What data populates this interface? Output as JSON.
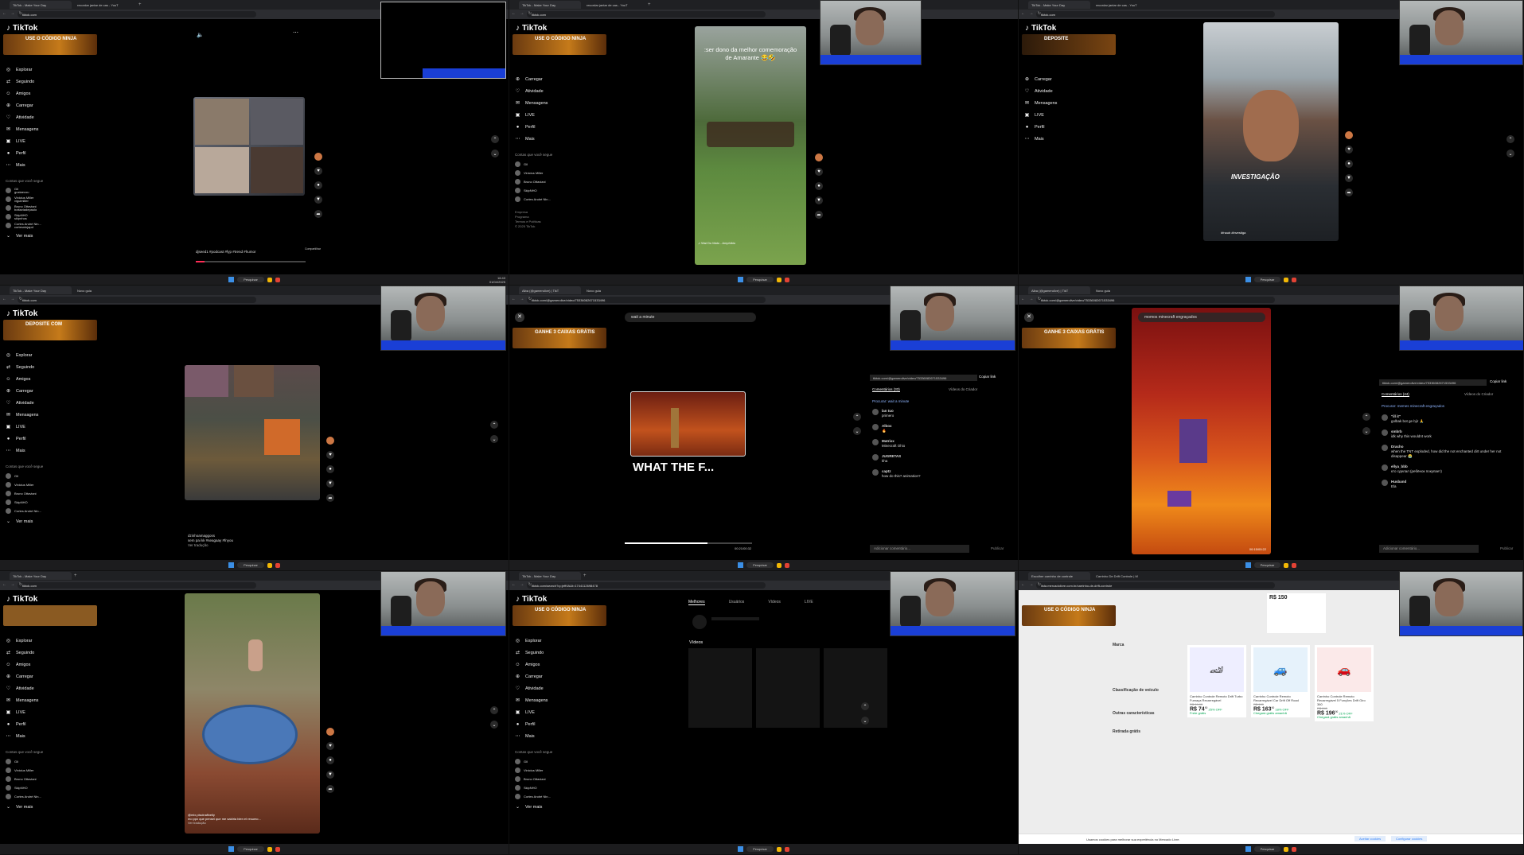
{
  "panels": [
    {
      "tabs": [
        "TikTok - Make Your Day",
        "recordar jantar de cas - YouT"
      ],
      "url": "tiktok.com",
      "logo": "TikTok",
      "banner": "USE O CÓDIGO NINJA",
      "sidebar": [
        "Explorar",
        "Seguindo",
        "Amigos",
        "Carregar",
        "Atividade",
        "Mensagens",
        "LIVE",
        "Perfil",
        "Mais"
      ],
      "following_heading": "Contas que você segue",
      "accounts": [
        {
          "name": "Gil",
          "handle": "gustaecou"
        },
        {
          "name": "Vinicius Miller",
          "handle": "viguimiller"
        },
        {
          "name": "Bruno Ottaviani",
          "handle": "bottaviadepaulo"
        },
        {
          "name": "SkipNHO",
          "handle": "skipnhos"
        },
        {
          "name": "Cortes André Nin...",
          "handle": "cortesninjapd"
        }
      ],
      "see_more": "Ver mais",
      "caption": "djseed1 #podcast #fyp #trend #humor",
      "share_label": "Compartilhar"
    },
    {
      "tabs": [
        "TikTok - Make Your Day",
        "recordar jantar de cas - YouT"
      ],
      "url": "tiktok.com",
      "banner": "USE O CÓDIGO NINJA",
      "overlay": ":ser dono da melhor comemoração de Amarante 😂🤣",
      "sidebar": [
        "Carregar",
        "Atividade",
        "Mensagens",
        "LIVE",
        "Perfil",
        "Mais"
      ],
      "footer": [
        "Empresa",
        "Programa",
        "Termos e Políticas",
        "© 2025 TikTok"
      ],
      "music": "♫ Wai Do Mato - Amphibio"
    },
    {
      "tabs": [
        "TikTok - Make Your Day",
        "recordar jantar de cas - YouT"
      ],
      "url": "tiktok.com",
      "banner": "DEPOSITE",
      "overlay": "INVESTIGAÇÃO",
      "caption": "#fnaub #investiga"
    },
    {
      "tabs": [
        "TikTok - Make Your Day",
        "Novo guia"
      ],
      "url": "tiktok.com",
      "banner": "DEPOSITE COM",
      "caption": "dzinhoamaggoss",
      "caption2": "sem pai kk #seagaay #fnyou",
      "translation": "Ver tradução"
    },
    {
      "tabs": [
        "Alba (@gamerolive) | TikT",
        "Novo guia"
      ],
      "url": "tiktok.com/@gamerolive/video/75336082671533496",
      "banner": "GANHE 3 CAIXAS GRÁTIS",
      "search": "wait a minute",
      "overlay": "WHAT THE F...",
      "timecode": "00:21/00:32",
      "copy_link": "Copiar link",
      "tab_comments": "Comentários (33)",
      "tab_creator": "Vídeos do Criador",
      "search_hint": "Procurar: wait a minute",
      "comments": [
        {
          "user": "lan tuo",
          "text": "primero"
        },
        {
          "user": "Albox",
          "text": "🔥"
        },
        {
          "user": "Matrixx",
          "text": "Minecraft Ohio"
        },
        {
          "user": "JUGRETAS",
          "text": "kha"
        },
        {
          "user": "captz",
          "text": "how do this? animation?"
        }
      ],
      "add_comment": "Adicionar comentário...",
      "post": "Publicar"
    },
    {
      "tabs": [
        "Alba (@gamerolive) | TikT",
        "Novo guia"
      ],
      "url": "tiktok.com/@gamerolive/video/75336082671533496",
      "banner": "GANHE 3 CAIXAS GRÁTIS",
      "search": "momos minecraft engraçados",
      "copy_link": "Copiar link",
      "tab_comments": "Comentários (44)",
      "tab_creator": "Vídeos do Criador",
      "search_hint": "Procurar: memes minecraft engraçados",
      "comments": [
        {
          "user": "\"ill it\"",
          "text": "golbak bot ge bjir 🙏"
        },
        {
          "user": "smbrb",
          "text": "idk why this wouldnt work"
        },
        {
          "user": "Dracho",
          "text": "when the TNT exploded, how did the not enchanted dirt under her not disappear 😭"
        },
        {
          "user": "ellya_bbb",
          "text": "кто сделал (ребёнок покупает)"
        },
        {
          "user": "Husband",
          "text": "Ela"
        }
      ],
      "add_comment": "Adicionar comentário...",
      "timecode": "00:15/00:22"
    },
    {
      "tabs": [
        "TikTok - Make Your Day"
      ],
      "url": "tiktok.com",
      "caption": "@mix.piscinaflxeily",
      "caption2": "mo ppx que pensei que me saldria bien el resumo...",
      "translation": "Ver tradução"
    },
    {
      "tabs": [
        "TikTok - Make Your Day"
      ],
      "url": "tiktok.com/search?q=jeffVA&t=1744112698478",
      "banner": "USE O CÓDIGO NINJA",
      "search_tabs": [
        "Melhores",
        "Usuários",
        "Vídeos",
        "LIVE"
      ],
      "videos_heading": "Vídeos"
    },
    {
      "tabs": [
        "Escolher carrinho de controle",
        "Carrinho De Drift Controle | M"
      ],
      "url": "lista.mercadolivre.com.br/carrinho-de-drift-controle",
      "banner": "USE O CÓDIGO NINJA",
      "filters": [
        "Marca",
        "Classificação de veículo",
        "Outras características",
        "Retirada grátis"
      ],
      "products": [
        {
          "title": "Carrinho Controle Remoto Drift Turbo Fumaça Recarregável",
          "old": "R$ 99,90",
          "price": "R$ 74",
          "cents": "90",
          "off": "25% OFF",
          "ship": "Frete grátis"
        },
        {
          "title": "Carrinho Controle Remoto Recarregável Car Drift Off Road",
          "old": "R$ 199",
          "price": "R$ 163",
          "cents": "90",
          "off": "18% OFF",
          "ship": "Chegará grátis amanhã"
        },
        {
          "title": "Carrinho Controle Remoto Recarregável 5 Funções Drift Giro 360",
          "old": "R$ 249",
          "price": "R$ 196",
          "cents": "90",
          "off": "21% OFF",
          "ship": "Chegará grátis amanhã"
        }
      ],
      "top_price": "R$ 150",
      "cookie_text": "Usamos cookies para melhorar sua experiência no Mercado Livre.",
      "cookie_accept": "Aceitar cookies",
      "cookie_config": "Configurar cookies"
    }
  ],
  "taskbar": {
    "search": "Pesquisar",
    "time": "16:43",
    "date": "01/04/2025"
  }
}
